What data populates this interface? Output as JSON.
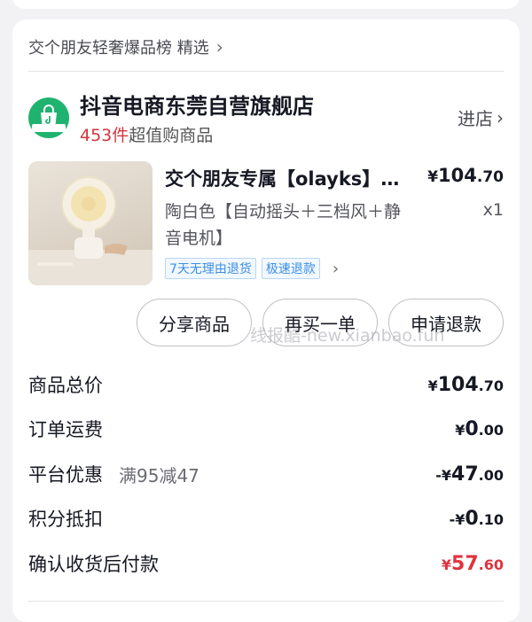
{
  "source": {
    "text": "交个朋友轻奢爆品榜 精选"
  },
  "store": {
    "name": "抖音电商东莞自营旗舰店",
    "count": "453件",
    "count_suffix": "超值购商品",
    "enter_label": "进店",
    "logo_text": "抖音电商"
  },
  "product": {
    "title": "交个朋友专属【olayks】立式风扇",
    "variant": "陶白色【自动摇头＋三档风＋静音电机】",
    "price_symbol": "¥",
    "price_int": "104",
    "price_dec": ".70",
    "quantity": "x1",
    "tags": [
      "7天无理由退货",
      "极速退款"
    ]
  },
  "actions": {
    "share": "分享商品",
    "rebuy": "再买一单",
    "refund": "申请退款"
  },
  "watermark": "线报酷-new.xianbao.fun",
  "summary": {
    "total": {
      "label": "商品总价",
      "sign": "",
      "symbol": "¥",
      "int": "104",
      "dec": ".70"
    },
    "shipping": {
      "label": "订单运费",
      "sign": "",
      "symbol": "¥",
      "int": "0",
      "dec": ".00"
    },
    "platform_discount": {
      "label": "平台优惠",
      "note": "满95减47",
      "sign": "-",
      "symbol": "¥",
      "int": "47",
      "dec": ".00"
    },
    "points": {
      "label": "积分抵扣",
      "sign": "-",
      "symbol": "¥",
      "int": "0",
      "dec": ".10"
    },
    "pay_after": {
      "label": "确认收货后付款",
      "sign": "",
      "symbol": "¥",
      "int": "57",
      "dec": ".60"
    }
  },
  "colors": {
    "accent_red": "#e0333e",
    "logo_green": "#1fb36f",
    "tag_blue": "#3a8ee6"
  }
}
